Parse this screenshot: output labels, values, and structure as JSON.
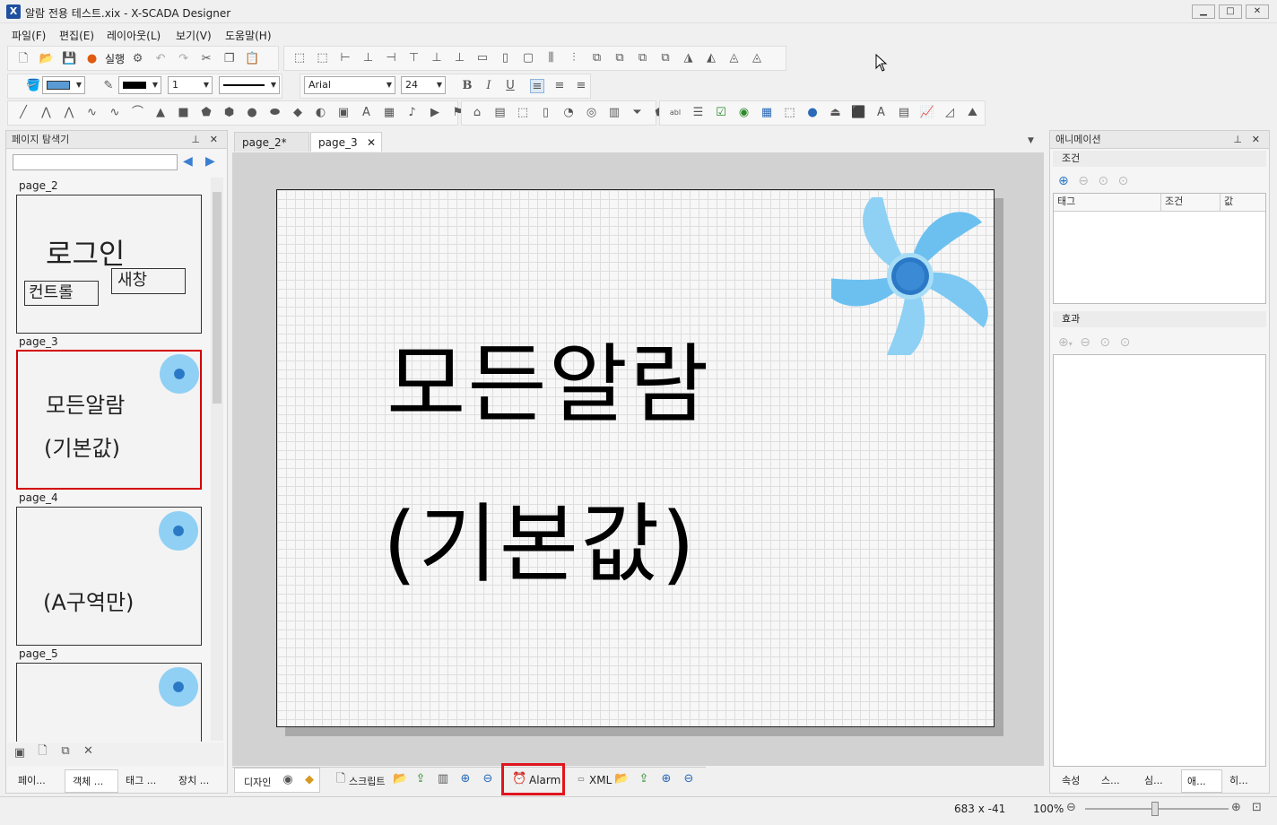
{
  "window": {
    "title": "알람 전용 테스트.xix - X-SCADA Designer",
    "minimize": "▁",
    "maximize": "□",
    "close": "✕"
  },
  "menu": [
    "파일(F)",
    "편집(E)",
    "레이아웃(L)",
    "보기(V)",
    "도움말(H)"
  ],
  "toolbar": {
    "run_label": "실행",
    "font_name": "Arial",
    "font_size": "24",
    "line_width": "1"
  },
  "page_explorer": {
    "title": "페이지 탐색기",
    "pages": [
      {
        "label": "page_2",
        "texts": [
          "로그인",
          "새창",
          "컨트롤"
        ]
      },
      {
        "label": "page_3",
        "texts": [
          "모든알람",
          "(기본값)"
        ]
      },
      {
        "label": "page_4",
        "texts": [
          "(A구역만)"
        ]
      },
      {
        "label": "page_5",
        "texts": []
      }
    ],
    "bottom_tabs": [
      "페이...",
      "객체 ...",
      "태그 ...",
      "장치 ..."
    ]
  },
  "editor": {
    "tabs": [
      "page_2*",
      "page_3"
    ],
    "line1": "모든알람",
    "line2": "(기본값)",
    "bottom_tabs": {
      "design": "디자인",
      "script": "스크립트",
      "alarm": "Alarm",
      "xml": "XML"
    }
  },
  "animation_panel": {
    "title": "애니메이션",
    "condition_section": "조건",
    "columns": [
      "태그",
      "조건",
      "값"
    ],
    "effect_section": "효과",
    "bottom_tabs": [
      "속성",
      "스...",
      "심...",
      "애...",
      "히..."
    ]
  },
  "status": {
    "coords": "683 x -41",
    "zoom": "100%"
  },
  "colors": {
    "highlight": "#e0141e",
    "fan_light": "#8fd0f4",
    "fan_dark": "#2a78c6",
    "page_thumb_selected": "#d40000"
  }
}
